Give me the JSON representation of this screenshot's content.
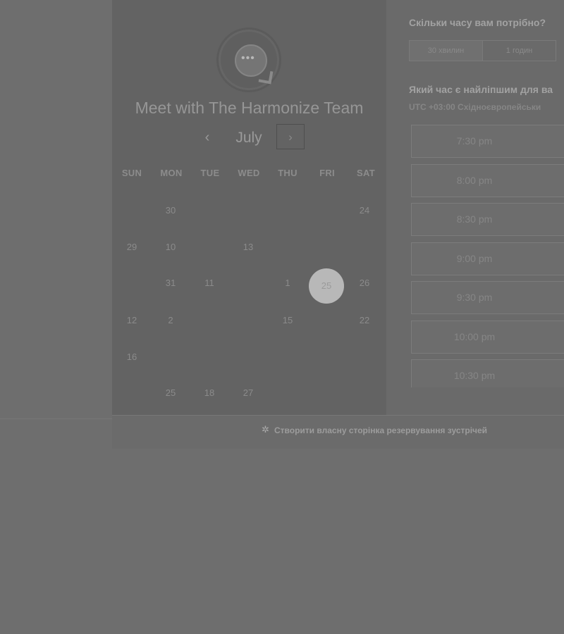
{
  "header": {
    "title": "Meet with The Harmonize Team",
    "logo_icon": "chat-bubble-icon"
  },
  "calendar": {
    "month": "July",
    "prev_label": "‹",
    "next_label": "›",
    "weekdays": [
      "SUN",
      "MON",
      "TUE",
      "WED",
      "THU",
      "FRI",
      "SAT"
    ],
    "days": [
      {
        "label": "30",
        "col": 1,
        "row": 0
      },
      {
        "label": "24",
        "col": 6,
        "row": 0
      },
      {
        "label": "29",
        "col": 0,
        "row": 1
      },
      {
        "label": "10",
        "col": 1,
        "row": 1
      },
      {
        "label": "13",
        "col": 3,
        "row": 1
      },
      {
        "label": "31",
        "col": 1,
        "row": 2
      },
      {
        "label": "11",
        "col": 2,
        "row": 2
      },
      {
        "label": "1",
        "col": 4,
        "row": 2
      },
      {
        "label": "25",
        "col": 5,
        "row": 2,
        "selected": true
      },
      {
        "label": "26",
        "col": 6,
        "row": 2
      },
      {
        "label": "12",
        "col": 0,
        "row": 3
      },
      {
        "label": "2",
        "col": 1,
        "row": 3
      },
      {
        "label": "15",
        "col": 4,
        "row": 3
      },
      {
        "label": "22",
        "col": 6,
        "row": 3
      },
      {
        "label": "16",
        "col": 0,
        "row": 4
      },
      {
        "label": "25",
        "col": 1,
        "row": 5
      },
      {
        "label": "18",
        "col": 2,
        "row": 5
      },
      {
        "label": "27",
        "col": 3,
        "row": 5
      }
    ]
  },
  "duration": {
    "question": "Скільки часу вам потрібно?",
    "options": [
      "30 хвилин",
      "1 годин"
    ]
  },
  "time": {
    "question": "Який час є найліпшим для ва",
    "timezone": "UTC +03:00 Східноєвропейськи",
    "slots": [
      "7:30 pm",
      "8:00 pm",
      "8:30 pm",
      "9:00 pm",
      "9:30 pm",
      "10:00 pm",
      "10:30 pm"
    ]
  },
  "footer": {
    "link": "Створити власну сторінка резервування зустрічей",
    "icon": "sprocket-icon"
  }
}
